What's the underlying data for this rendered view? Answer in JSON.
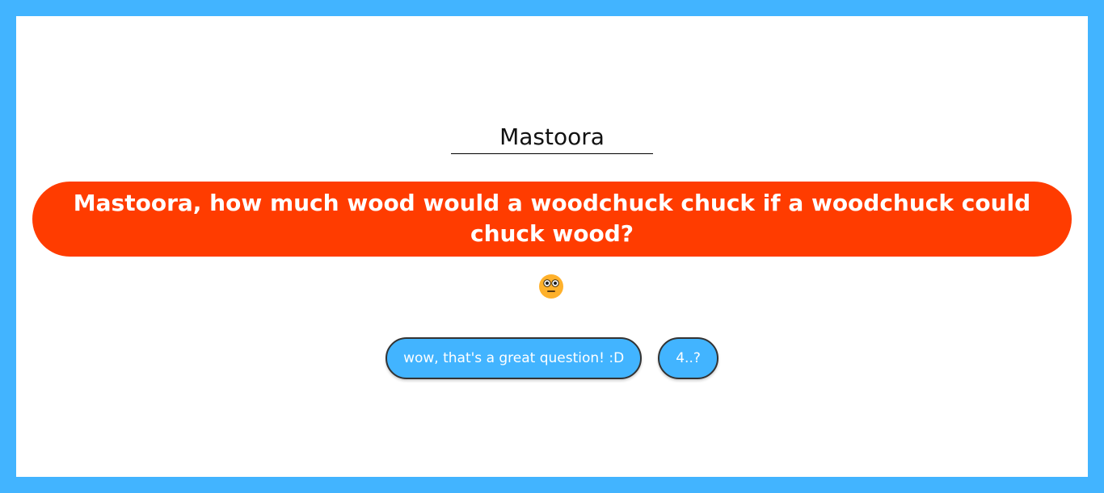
{
  "name_input": {
    "value": "Mastoora"
  },
  "question": {
    "text": "Mastoora, how much wood would a woodchuck chuck if a woodchuck could chuck wood?"
  },
  "reaction": {
    "icon": "neutral-face-icon"
  },
  "answers": [
    {
      "label": "wow, that's a great question! :D"
    },
    {
      "label": "4..?"
    }
  ],
  "colors": {
    "border": "#42b4ff",
    "question_bg": "#ff3c00",
    "button_bg": "#42b4ff",
    "face": "#ffb12b"
  }
}
